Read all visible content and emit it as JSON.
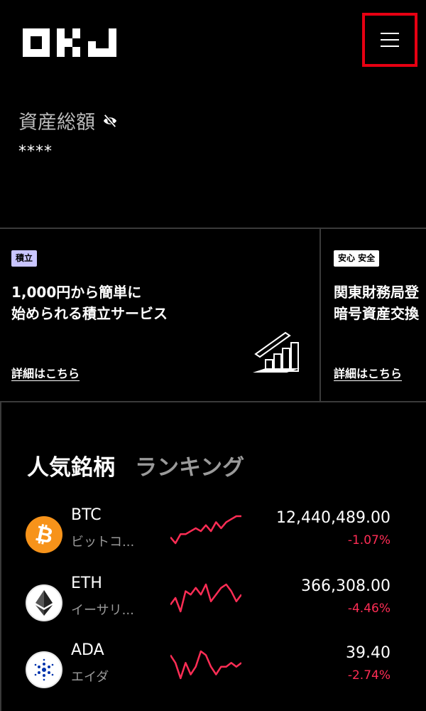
{
  "header": {
    "logo_text": "OKJ",
    "menu_icon": "hamburger-menu-icon",
    "menu_highlight_color": "#e60012"
  },
  "assets": {
    "title": "資産総額",
    "visibility_icon": "eye-slash-icon",
    "value": "****"
  },
  "banners": [
    {
      "tag": "積立",
      "tag_color": "#c9c5ff",
      "text": "1,000円から簡単に\n始められる積立サービス",
      "link": "詳細はこちら",
      "illustration": "growth-chart-icon"
    },
    {
      "tag": "安心 安全",
      "tag_color": "#ffffff",
      "text": "関東財務局登\n暗号資産交換",
      "link": "詳細はこちら"
    }
  ],
  "ranking": {
    "tabs": [
      "人気銘柄",
      "ランキング"
    ],
    "active_tab": "人気銘柄",
    "negative_color": "#ff2d55",
    "coins": [
      {
        "symbol": "BTC",
        "name": "ビットコ...",
        "price": "12,440,489.00",
        "change": "-1.07%",
        "icon": "bitcoin-icon",
        "icon_color": "#f7931a",
        "spark": [
          3,
          1,
          4,
          4,
          5,
          6,
          5,
          7,
          5,
          8,
          6,
          8,
          9,
          10,
          10
        ]
      },
      {
        "symbol": "ETH",
        "name": "イーサリ...",
        "price": "366,308.00",
        "change": "-4.46%",
        "icon": "ethereum-icon",
        "icon_color": "#ffffff",
        "spark": [
          3,
          5,
          1,
          7,
          6,
          8,
          6,
          9,
          4,
          6,
          8,
          9,
          7,
          4,
          6
        ]
      },
      {
        "symbol": "ADA",
        "name": "エイダ",
        "price": "39.40",
        "change": "-2.74%",
        "icon": "cardano-icon",
        "icon_color": "#ffffff",
        "spark": [
          8,
          6,
          2,
          6,
          3,
          5,
          9,
          8,
          5,
          3,
          5,
          5,
          6,
          5,
          6
        ]
      }
    ]
  }
}
